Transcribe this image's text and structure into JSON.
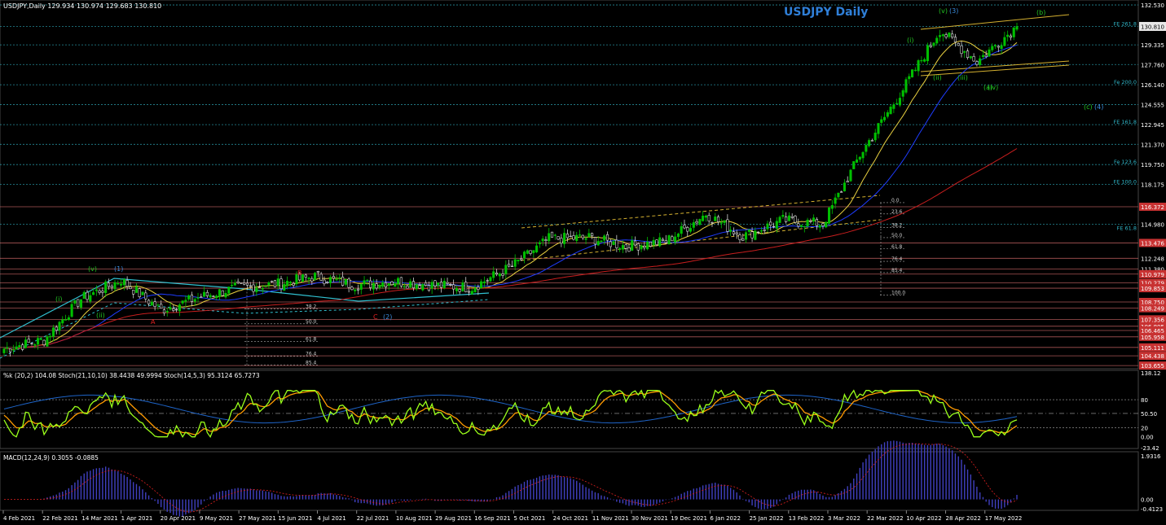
{
  "main_chart": {
    "header": "USDJPY,Daily  129.934 130.974 129.683 130.810",
    "title": "USDJPY Daily",
    "price_ticks": [
      "132.530",
      "130.810",
      "129.335",
      "127.760",
      "126.140",
      "124.555",
      "122.945",
      "121.370",
      "119.750",
      "118.175",
      "116.372",
      "114.980",
      "113.476",
      "112.248",
      "111.380",
      "110.979",
      "110.279",
      "109.853",
      "108.750",
      "108.249",
      "107.356",
      "106.805",
      "106.465",
      "105.958",
      "105.111",
      "104.438",
      "103.655"
    ],
    "ylim": [
      103.6,
      132.6
    ],
    "current_price": 130.81,
    "fib_extension_labels": [
      {
        "label": "FE 261.8",
        "price": 130.81
      },
      {
        "label": "Fe 200.0",
        "price": 126.14
      },
      {
        "label": "FE 161.8",
        "price": 122.945
      },
      {
        "label": "Fe 123.6",
        "price": 119.75
      },
      {
        "label": "FE 100.0",
        "price": 118.175
      },
      {
        "label": "FE 61.8",
        "price": 114.46
      }
    ],
    "retracement_left": [
      "38.2",
      "50.0",
      "61.8",
      "76.4",
      "85.4"
    ],
    "retracement_right": [
      "0.0",
      "23.6",
      "38.2",
      "50.0",
      "61.8",
      "76.4",
      "85.4",
      "100.0"
    ],
    "wave_labels": [
      {
        "text": "(v)",
        "color": "#22c322"
      },
      {
        "text": "(1)",
        "color": "#3a8bdc"
      },
      {
        "text": "(i)",
        "color": "#22c322"
      },
      {
        "text": "(ii)",
        "color": "#22c322"
      },
      {
        "text": "B",
        "color": "#e02020"
      },
      {
        "text": "A",
        "color": "#e02020"
      },
      {
        "text": "C",
        "color": "#e02020"
      },
      {
        "text": "(2)",
        "color": "#3a8bdc"
      },
      {
        "text": "(i)",
        "color": "#22c322"
      },
      {
        "text": "(ii)",
        "color": "#22c322"
      },
      {
        "text": "(iii)",
        "color": "#22c322"
      },
      {
        "text": "(v)",
        "color": "#22c322"
      },
      {
        "text": "(3)",
        "color": "#3a8bdc"
      },
      {
        "text": "(iv)",
        "color": "#22c322"
      },
      {
        "text": "(a)",
        "color": "#22c322"
      },
      {
        "text": "(b)",
        "color": "#22c322"
      },
      {
        "text": "(c)",
        "color": "#22c322"
      },
      {
        "text": "(4)",
        "color": "#3a8bdc"
      }
    ]
  },
  "stoch_panel": {
    "header": "%k (20,2) 104.08  Stoch(21,10,10) 38.4438 49.9994  Stoch(14,5,3) 95.3124 65.7273",
    "ticks": [
      "138.12",
      "80",
      "50.50",
      "20",
      "0.00",
      "-23.42"
    ]
  },
  "macd_panel": {
    "header": "MACD(12,24,9) 0.3055 -0.0885",
    "ticks": [
      "1.9316",
      "0.00",
      "-0.4123"
    ]
  },
  "date_ticks": [
    "4 Feb 2021",
    "22 Feb 2021",
    "14 Mar 2021",
    "1 Apr 2021",
    "20 Apr 2021",
    "9 May 2021",
    "27 May 2021",
    "15 Jun 2021",
    "4 Jul 2021",
    "22 Jul 2021",
    "10 Aug 2021",
    "29 Aug 2021",
    "16 Sep 2021",
    "5 Oct 2021",
    "24 Oct 2021",
    "11 Nov 2021",
    "30 Nov 2021",
    "19 Dec 2021",
    "6 Jan 2022",
    "25 Jan 2022",
    "13 Feb 2022",
    "3 Mar 2022",
    "22 Mar 2022",
    "10 Apr 2022",
    "28 Apr 2022",
    "17 May 2022"
  ],
  "chart_data": {
    "type": "line",
    "series_name": "USDJPY Daily close",
    "dates": [
      "4 Feb 2021",
      "22 Feb 2021",
      "14 Mar 2021",
      "1 Apr 2021",
      "20 Apr 2021",
      "9 May 2021",
      "27 May 2021",
      "15 Jun 2021",
      "4 Jul 2021",
      "22 Jul 2021",
      "10 Aug 2021",
      "29 Aug 2021",
      "16 Sep 2021",
      "5 Oct 2021",
      "24 Oct 2021",
      "11 Nov 2021",
      "30 Nov 2021",
      "19 Dec 2021",
      "6 Jan 2022",
      "25 Jan 2022",
      "13 Feb 2022",
      "3 Mar 2022",
      "22 Mar 2022",
      "10 Apr 2022",
      "28 Apr 2022",
      "17 May 2022"
    ],
    "close": [
      105.0,
      105.7,
      109.0,
      110.5,
      108.1,
      109.1,
      109.9,
      110.2,
      110.8,
      110.1,
      110.4,
      110.1,
      109.9,
      111.6,
      113.8,
      113.9,
      113.2,
      113.6,
      115.8,
      114.0,
      115.3,
      115.0,
      120.5,
      125.4,
      130.5,
      128.0
    ],
    "last_close": 130.81,
    "moving_averages": [
      "fast (yellow)",
      "mid (blue)",
      "slow (red)"
    ],
    "ylim": [
      103.6,
      132.6
    ]
  },
  "colors": {
    "bull_candle": "#00c000",
    "bear_candle": "#ffffff",
    "grid": "#2a2a2a",
    "fib_line": "#30b6c8",
    "support_line": "#e07070",
    "ma_fast": "#e8d040",
    "ma_mid": "#1e3cff",
    "ma_slow": "#c81e1e",
    "stoch_k": "#9aff1a",
    "stoch_d": "#ff9a00",
    "macd_hist": "#4040c0",
    "macd_signal": "#e02020"
  }
}
